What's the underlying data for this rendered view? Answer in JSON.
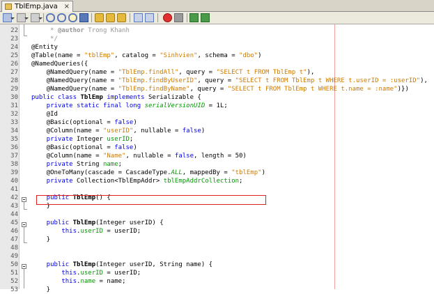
{
  "tab": {
    "title": "TblEmp.java",
    "close": "×"
  },
  "toolbar": {
    "buttons": [
      "last-edit-icon",
      "back-icon",
      "forward-icon",
      "find-previous-icon",
      "find-next-icon",
      "find-selection-icon",
      "toggle-highlight-icon",
      "previous-bookmark-icon",
      "next-bookmark-icon",
      "toggle-bookmark-icon",
      "shift-left-icon",
      "shift-right-icon",
      "start-macro-icon",
      "stop-macro-icon",
      "comment-icon",
      "uncomment-icon"
    ],
    "colors": {
      "macro_record": "#e03030",
      "macro_stop": "#9a9a9a",
      "icon_blue": "#5a79b8",
      "icon_yellow": "#e5b93a",
      "icon_green": "#4a9a4a"
    }
  },
  "editor": {
    "highlight_color": "#e02020",
    "margin_color": "#f3a0a0",
    "lines": [
      {
        "n": "22",
        "t": [
          [
            "cm",
            "     * "
          ],
          [
            "cmb",
            "@author"
          ],
          [
            "cm",
            " Trong Khanh"
          ]
        ]
      },
      {
        "n": "23",
        "t": [
          [
            "cm",
            "     */"
          ]
        ]
      },
      {
        "n": "24",
        "t": [
          [
            "an",
            "@Entity"
          ]
        ]
      },
      {
        "n": "25",
        "t": [
          [
            "an",
            "@Table(name = "
          ],
          [
            "st",
            "\"tblEmp\""
          ],
          [
            "an",
            ", catalog = "
          ],
          [
            "st",
            "\"Sinhvien\""
          ],
          [
            "an",
            ", schema = "
          ],
          [
            "st",
            "\"dbo\""
          ],
          [
            "an",
            ")"
          ]
        ]
      },
      {
        "n": "26",
        "t": [
          [
            "an",
            "@NamedQueries({"
          ]
        ]
      },
      {
        "n": "27",
        "t": [
          [
            "an",
            "    @NamedQuery(name = "
          ],
          [
            "st",
            "\"TblEmp.findAll\""
          ],
          [
            "an",
            ", query = "
          ],
          [
            "st",
            "\"SELECT t FROM TblEmp t\""
          ],
          [
            "an",
            "),"
          ]
        ]
      },
      {
        "n": "28",
        "t": [
          [
            "an",
            "    @NamedQuery(name = "
          ],
          [
            "st",
            "\"TblEmp.findByUserID\""
          ],
          [
            "an",
            ", query = "
          ],
          [
            "st",
            "\"SELECT t FROM TblEmp t WHERE t.userID = :userID\""
          ],
          [
            "an",
            "),"
          ]
        ]
      },
      {
        "n": "29",
        "t": [
          [
            "an",
            "    @NamedQuery(name = "
          ],
          [
            "st",
            "\"TblEmp.findByName\""
          ],
          [
            "an",
            ", query = "
          ],
          [
            "st",
            "\"SELECT t FROM TblEmp t WHERE t.name = :name\""
          ],
          [
            "an",
            ")})"
          ]
        ]
      },
      {
        "n": "30",
        "t": [
          [
            "kw",
            "public class "
          ],
          [
            "bd",
            "TblEmp"
          ],
          [
            "kw",
            " implements"
          ],
          [
            "an",
            " Serializable {"
          ]
        ]
      },
      {
        "n": "31",
        "t": [
          [
            "kw",
            "    private static final long "
          ],
          [
            "fdi",
            "serialVersionUID"
          ],
          [
            "an",
            " = 1L;"
          ]
        ]
      },
      {
        "n": "32",
        "t": [
          [
            "an",
            "    @Id"
          ]
        ]
      },
      {
        "n": "33",
        "t": [
          [
            "an",
            "    @Basic(optional = "
          ],
          [
            "kw",
            "false"
          ],
          [
            "an",
            ")"
          ]
        ]
      },
      {
        "n": "34",
        "t": [
          [
            "an",
            "    @Column(name = "
          ],
          [
            "st",
            "\"userID\""
          ],
          [
            "an",
            ", nullable = "
          ],
          [
            "kw",
            "false"
          ],
          [
            "an",
            ")"
          ]
        ]
      },
      {
        "n": "35",
        "t": [
          [
            "kw",
            "    private"
          ],
          [
            "an",
            " Integer "
          ],
          [
            "fd",
            "userID"
          ],
          [
            "an",
            ";"
          ]
        ]
      },
      {
        "n": "36",
        "t": [
          [
            "an",
            "    @Basic(optional = "
          ],
          [
            "kw",
            "false"
          ],
          [
            "an",
            ")"
          ]
        ]
      },
      {
        "n": "37",
        "t": [
          [
            "an",
            "    @Column(name = "
          ],
          [
            "st",
            "\"Name\""
          ],
          [
            "an",
            ", nullable = "
          ],
          [
            "kw",
            "false"
          ],
          [
            "an",
            ", length = 50)"
          ]
        ]
      },
      {
        "n": "38",
        "t": [
          [
            "kw",
            "    private"
          ],
          [
            "an",
            " String "
          ],
          [
            "fd",
            "name"
          ],
          [
            "an",
            ";"
          ]
        ]
      },
      {
        "n": "39",
        "t": [
          [
            "an",
            "    @OneToMany(cascade = CascadeType."
          ],
          [
            "fdi",
            "ALL"
          ],
          [
            "an",
            ", mappedBy = "
          ],
          [
            "st",
            "\"tblEmp\""
          ],
          [
            "an",
            ")"
          ]
        ]
      },
      {
        "n": "40",
        "t": [
          [
            "kw",
            "    private"
          ],
          [
            "an",
            " Collection<TblEmpAddr> "
          ],
          [
            "fd",
            "tblEmpAddrCollection"
          ],
          [
            "an",
            ";"
          ]
        ]
      },
      {
        "n": "41",
        "t": []
      },
      {
        "n": "42",
        "t": [
          [
            "kw",
            "    public "
          ],
          [
            "bd",
            "TblEmp"
          ],
          [
            "an",
            "() {"
          ]
        ]
      },
      {
        "n": "43",
        "t": [
          [
            "an",
            "    }"
          ]
        ]
      },
      {
        "n": "44",
        "t": []
      },
      {
        "n": "45",
        "t": [
          [
            "kw",
            "    public "
          ],
          [
            "bd",
            "TblEmp"
          ],
          [
            "an",
            "(Integer userID) {"
          ]
        ]
      },
      {
        "n": "46",
        "t": [
          [
            "kw",
            "        this"
          ],
          [
            "an",
            "."
          ],
          [
            "fd",
            "userID"
          ],
          [
            "an",
            " = userID;"
          ]
        ]
      },
      {
        "n": "47",
        "t": [
          [
            "an",
            "    }"
          ]
        ]
      },
      {
        "n": "48",
        "t": []
      },
      {
        "n": "49",
        "t": []
      },
      {
        "n": "50",
        "t": [
          [
            "kw",
            "    public "
          ],
          [
            "bd",
            "TblEmp"
          ],
          [
            "an",
            "(Integer userID, String name) {"
          ]
        ]
      },
      {
        "n": "51",
        "t": [
          [
            "kw",
            "        this"
          ],
          [
            "an",
            "."
          ],
          [
            "fd",
            "userID"
          ],
          [
            "an",
            " = userID;"
          ]
        ]
      },
      {
        "n": "52",
        "t": [
          [
            "kw",
            "        this"
          ],
          [
            "an",
            "."
          ],
          [
            "fd",
            "name"
          ],
          [
            "an",
            " = name;"
          ]
        ]
      },
      {
        "n": "53",
        "t": [
          [
            "an",
            "    }"
          ]
        ]
      }
    ]
  }
}
